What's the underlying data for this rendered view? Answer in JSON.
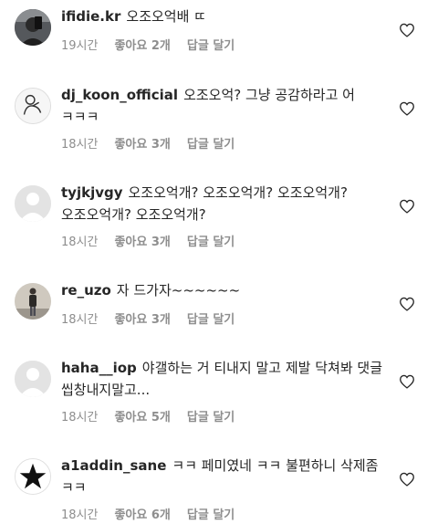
{
  "comments": [
    {
      "username": "ifidie.kr",
      "text": "오조오억배 ㄸ",
      "time": "19시간",
      "likes": "좋아요 2개",
      "reply": "답글 달기",
      "avatar": "dark-selfie"
    },
    {
      "username": "dj_koon_official",
      "text": "오조오억? 그냥 공감하라고 어 ㅋㅋㅋ",
      "time": "18시간",
      "likes": "좋아요 3개",
      "reply": "답글 달기",
      "avatar": "sketch-person"
    },
    {
      "username": "tyjkjvgy",
      "text": "오조오억개? 오조오억개? 오조오억개? 오조오억개? 오조오억개?",
      "time": "18시간",
      "likes": "좋아요 3개",
      "reply": "답글 달기",
      "avatar": "default"
    },
    {
      "username": "re_uzo",
      "text": "자 드가자~~~~~~",
      "time": "18시간",
      "likes": "좋아요 3개",
      "reply": "답글 달기",
      "avatar": "standing-person"
    },
    {
      "username": "haha__iop",
      "text": "야갤하는 거 티내지 말고 제발 닥쳐봐 댓글 씹창내지말고...",
      "time": "18시간",
      "likes": "좋아요 5개",
      "reply": "답글 달기",
      "avatar": "default"
    },
    {
      "username": "a1addin_sane",
      "text": "ㅋㅋ 페미였네 ㅋㅋ 불편하니 삭제좀 ㅋㅋ",
      "time": "18시간",
      "likes": "좋아요 6개",
      "reply": "답글 달기",
      "avatar": "star-logo"
    }
  ],
  "icons": {
    "like": "heart-outline-icon"
  },
  "colors": {
    "text": "#262626",
    "meta": "#8e8e8e",
    "avatar_bg": "#e9e9e9"
  }
}
